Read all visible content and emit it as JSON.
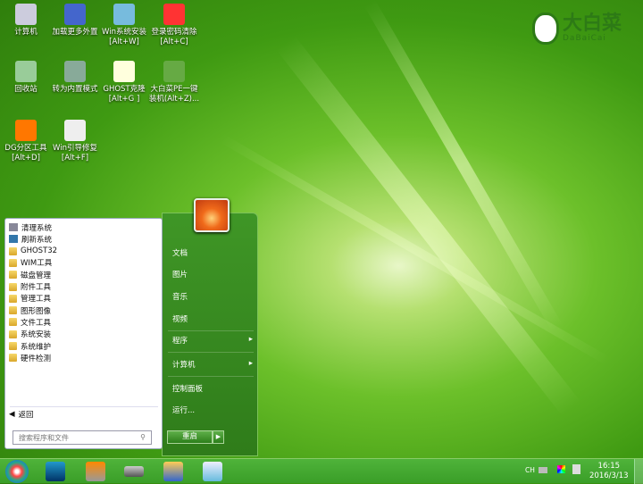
{
  "desktop_icons": [
    {
      "label": "计算机",
      "sub": ""
    },
    {
      "label": "加载更多外置",
      "sub": ""
    },
    {
      "label": "Win系统安装",
      "sub": "[Alt+W]"
    },
    {
      "label": "登录密码清除",
      "sub": "[Alt+C]"
    },
    {
      "label": "回收站",
      "sub": ""
    },
    {
      "label": "转为内置模式",
      "sub": ""
    },
    {
      "label": "GHOST克隆",
      "sub": "[Alt+G ]"
    },
    {
      "label": "大白菜PE一键",
      "sub": "装机(Alt+Z)..."
    },
    {
      "label": "DG分区工具",
      "sub": "[Alt+D]"
    },
    {
      "label": "Win引导修复",
      "sub": "[Alt+F]"
    }
  ],
  "logo": {
    "cn": "大白菜",
    "en": "DaBaiCai"
  },
  "start_menu": {
    "left_items": [
      "清理系统",
      "刷新系统",
      "GHOST32",
      "WIM工具",
      "磁盘管理",
      "附件工具",
      "管理工具",
      "图形图像",
      "文件工具",
      "系统安装",
      "系统维护",
      "硬件检测"
    ],
    "back": "返回",
    "search_placeholder": "搜索程序和文件",
    "right_items": [
      "文档",
      "图片",
      "音乐",
      "视频",
      "程序",
      "计算机",
      "控制面板",
      "运行..."
    ],
    "shutdown": "重启"
  },
  "tray": {
    "lang": "CH",
    "time": "16:15",
    "date": "2016/3/13"
  }
}
